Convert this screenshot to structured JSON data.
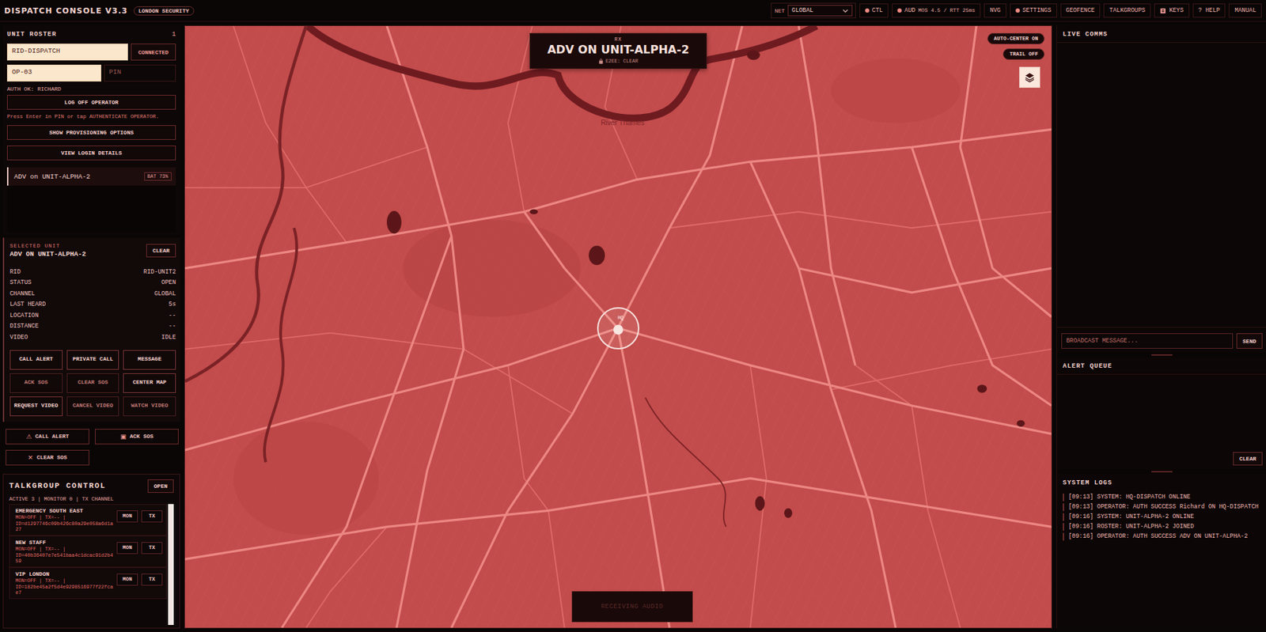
{
  "app": {
    "title": "DISPATCH CONSOLE V3.3",
    "badge": "LONDON SECURITY"
  },
  "toolbar": {
    "net_label": "NET",
    "net_value": "GLOBAL",
    "items": [
      {
        "label": "CTL",
        "kind": "dot"
      },
      {
        "label": "AUD",
        "kind": "dot",
        "detail": "MOS 4.5 / RTT 25ms"
      },
      {
        "label": "NVG",
        "kind": "plain"
      },
      {
        "label": "SETTINGS",
        "kind": "dot"
      },
      {
        "label": "GEOFENCE",
        "kind": "plain"
      },
      {
        "label": "TALKGROUPS",
        "kind": "plain"
      },
      {
        "label": "KEYS",
        "kind": "icon"
      },
      {
        "label": "? HELP",
        "kind": "plain"
      },
      {
        "label": "MANUAL",
        "kind": "plain"
      }
    ]
  },
  "roster": {
    "title": "UNIT ROSTER",
    "count": "1",
    "dispatch_id": "RID-DISPATCH",
    "connection": "CONNECTED",
    "operator_id": "OP-03",
    "pin_placeholder": "PIN",
    "auth": "AUTH OK: RICHARD",
    "logoff": "LOG OFF OPERATOR",
    "hint": "Press Enter in PIN or tap AUTHENTICATE OPERATOR.",
    "buttons": [
      "SHOW PROVISIONING OPTIONS",
      "VIEW LOGIN DETAILS"
    ],
    "units": [
      {
        "name": "ADV on UNIT-ALPHA-2",
        "battery": "BAT 73%",
        "selected": true
      }
    ]
  },
  "selected_unit": {
    "label": "SELECTED UNIT",
    "name": "ADV ON UNIT-ALPHA-2",
    "clear": "CLEAR",
    "fields": [
      {
        "key": "RID",
        "value": "RID-UNIT2"
      },
      {
        "key": "STATUS",
        "value": "OPEN"
      },
      {
        "key": "CHANNEL",
        "value": "GLOBAL"
      },
      {
        "key": "LAST HEARD",
        "value": "5s"
      },
      {
        "key": "LOCATION",
        "value": "--"
      },
      {
        "key": "DISTANCE",
        "value": "--"
      },
      {
        "key": "VIDEO",
        "value": "IDLE"
      }
    ],
    "actions": [
      {
        "label": "CALL ALERT",
        "disabled": false
      },
      {
        "label": "PRIVATE CALL",
        "disabled": false
      },
      {
        "label": "MESSAGE",
        "disabled": false
      },
      {
        "label": "ACK SOS",
        "disabled": true
      },
      {
        "label": "CLEAR SOS",
        "disabled": true
      },
      {
        "label": "CENTER MAP",
        "disabled": false
      },
      {
        "label": "REQUEST VIDEO",
        "disabled": false
      },
      {
        "label": "CANCEL VIDEO",
        "disabled": true
      },
      {
        "label": "WATCH VIDEO",
        "disabled": true
      }
    ]
  },
  "quick_actions": [
    {
      "glyph": "⚠",
      "label": "CALL ALERT"
    },
    {
      "glyph": "▣",
      "label": "ACK SOS"
    },
    {
      "glyph": "✕",
      "label": "CLEAR SOS"
    }
  ],
  "talkgroups": {
    "title": "TALKGROUP CONTROL",
    "open": "OPEN",
    "summary": "ACTIVE 3 | MONITOR 0 | TX CHANNEL",
    "buttons": [
      "MON",
      "TX"
    ],
    "groups": [
      {
        "name": "EMERGENCY SOUTH EAST",
        "status": "MON=OFF | TX=-- |",
        "id": "ID=d1297746c09b426c80a29e058a6d1a27"
      },
      {
        "name": "NEW STAFF",
        "status": "MON=OFF | TX=-- |",
        "id": "ID=40b36407e7e541baa4c1dcac91d2b459"
      },
      {
        "name": "VIP LONDON",
        "status": "MON=OFF | TX=-- |",
        "id": "ID=182be45a2f5d4e9298516977f22fcae7"
      }
    ]
  },
  "map": {
    "river_label": "River Thames",
    "marker": "HQ",
    "rx": {
      "tag": "RX",
      "title": "ADV ON UNIT-ALPHA-2",
      "encryption": "E2EE: CLEAR"
    },
    "controls": [
      "AUTO-CENTER ON",
      "TRAIL OFF"
    ],
    "audio": {
      "label": "RECEIVING AUDIO",
      "active": false
    }
  },
  "live_comms": {
    "title": "LIVE COMMS",
    "placeholder": "BROADCAST MESSAGE...",
    "send": "SEND"
  },
  "alert_queue": {
    "title": "ALERT QUEUE",
    "clear": "CLEAR"
  },
  "system_logs": {
    "title": "SYSTEM LOGS",
    "entries": [
      {
        "time": "[09:13]",
        "text": "SYSTEM: HQ-DISPATCH ONLINE"
      },
      {
        "time": "[09:13]",
        "text": "OPERATOR: AUTH SUCCESS Richard ON HQ-DISPATCH"
      },
      {
        "time": "[09:16]",
        "text": "SYSTEM: UNIT-ALPHA-2 ONLINE"
      },
      {
        "time": "[09:16]",
        "text": "ROSTER: UNIT-ALPHA-2 JOINED"
      },
      {
        "time": "[09:16]",
        "text": "OPERATOR: AUTH SUCCESS ADV ON UNIT-ALPHA-2"
      }
    ]
  }
}
